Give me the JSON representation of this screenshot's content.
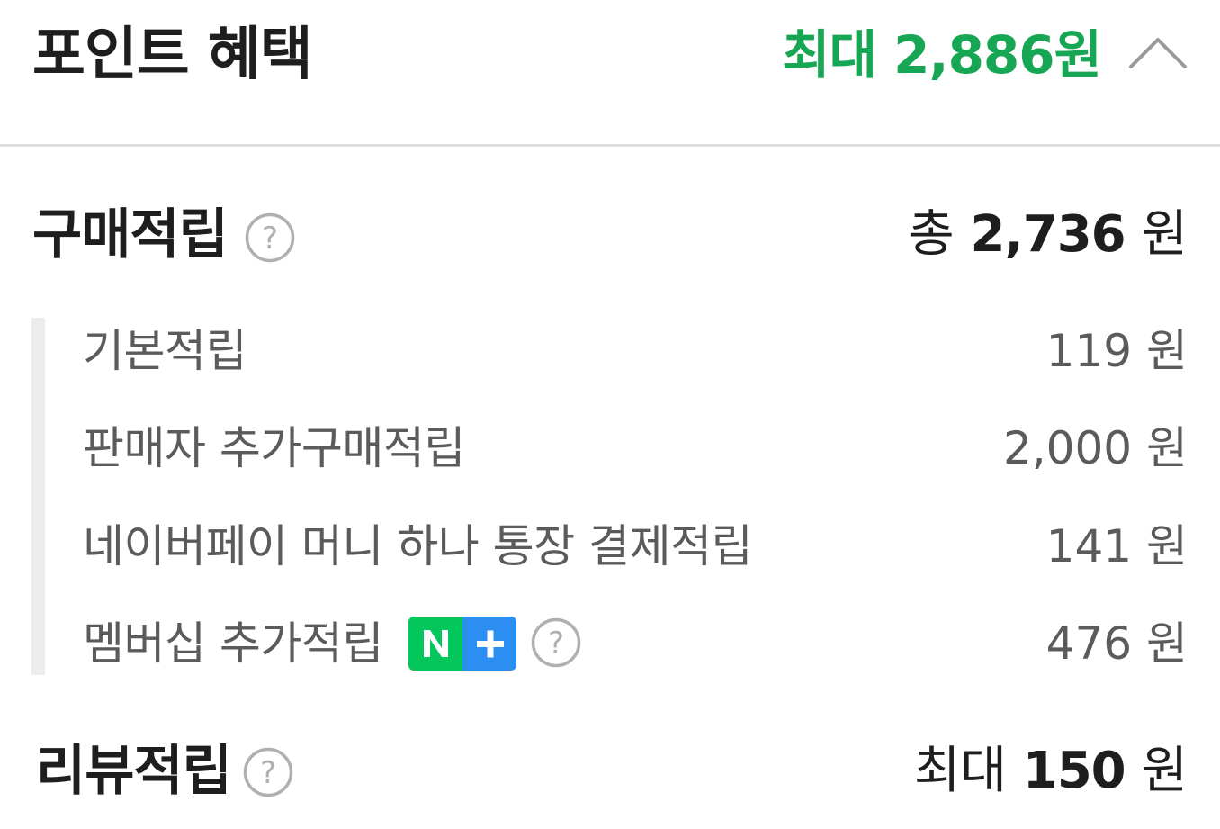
{
  "header": {
    "title": "포인트 혜택",
    "max_benefit": "최대 2,886원",
    "collapse_icon": "chevron-up-icon"
  },
  "purchase": {
    "title": "구매적립",
    "help_icon": "question-circle-icon",
    "total_prefix": "총",
    "total_amount": "2,736",
    "total_unit": "원",
    "items": [
      {
        "label": "기본적립",
        "value": "119 원"
      },
      {
        "label": "판매자 추가구매적립",
        "value": "2,000 원"
      },
      {
        "label": "네이버페이 머니 하나 통장 결제적립",
        "value": "141 원"
      },
      {
        "label": "멤버십 추가적립",
        "value": "476 원",
        "badge_icon": "naver-plus-membership-icon",
        "help_icon": "question-circle-icon"
      }
    ]
  },
  "review": {
    "title": "리뷰적립",
    "help_icon": "question-circle-icon",
    "max_prefix": "최대",
    "max_amount": "150",
    "max_unit": "원"
  },
  "colors": {
    "accent_green": "#16a654",
    "text_dark": "#1e1e1e",
    "text_gray": "#5b5b5b",
    "badge_green": "#03c75a",
    "badge_blue": "#2d8ef2"
  }
}
